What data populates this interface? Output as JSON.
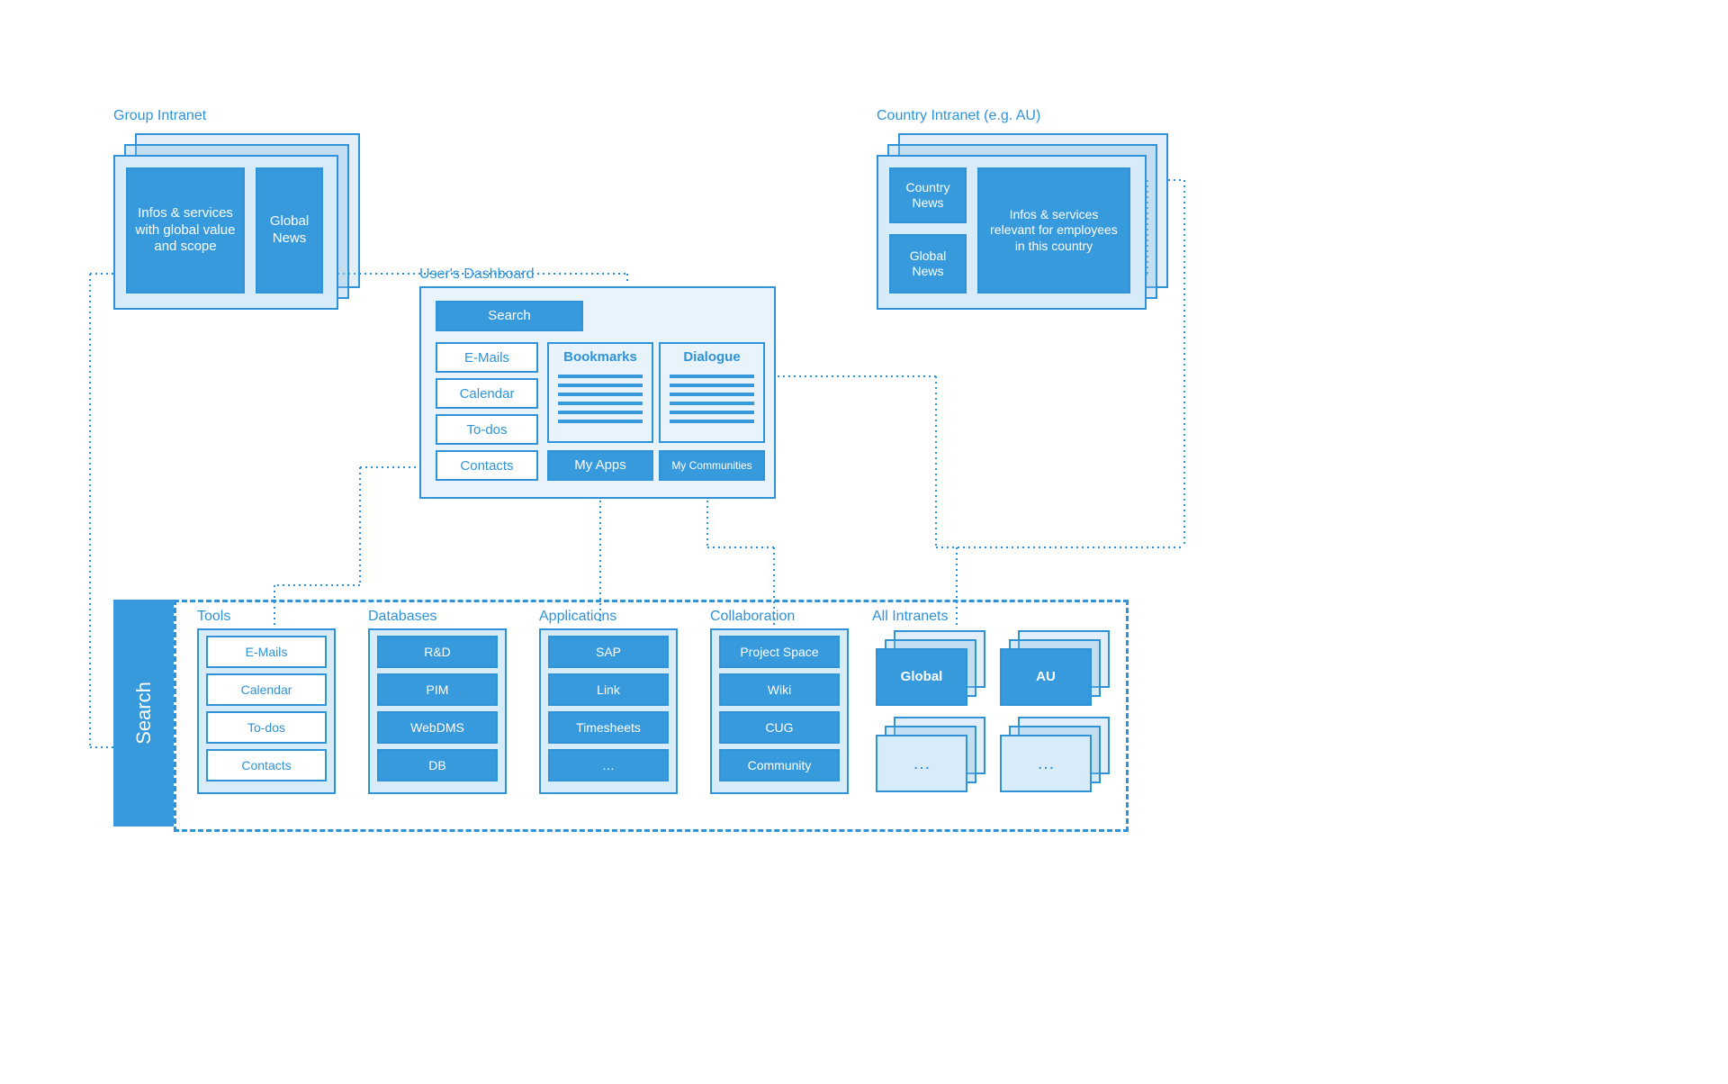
{
  "group_intranet": {
    "title": "Group Intranet",
    "info_block": "Infos & services with global value and scope",
    "news_block": "Global News"
  },
  "country_intranet": {
    "title": "Country Intranet (e.g. AU)",
    "country_news": "Country News",
    "global_news": "Global News",
    "info_block": "Infos & services relevant for employees in this country"
  },
  "dashboard": {
    "title": "User's Dashboard",
    "search": "Search",
    "left_items": [
      "E-Mails",
      "Calendar",
      "To-dos",
      "Contacts"
    ],
    "bookmarks_title": "Bookmarks",
    "dialogue_title": "Dialogue",
    "my_apps": "My Apps",
    "my_communities": "My Communities"
  },
  "search_label": "Search",
  "sections": {
    "tools": {
      "title": "Tools",
      "items": [
        "E-Mails",
        "Calendar",
        "To-dos",
        "Contacts"
      ],
      "style": "outline"
    },
    "databases": {
      "title": "Databases",
      "items": [
        "R&D",
        "PIM",
        "WebDMS",
        "DB"
      ],
      "style": "solid"
    },
    "applications": {
      "title": "Applications",
      "items": [
        "SAP",
        "Link",
        "Timesheets",
        "…"
      ],
      "style": "solid"
    },
    "collaboration": {
      "title": "Collaboration",
      "items": [
        "Project Space",
        "Wiki",
        "CUG",
        "Community"
      ],
      "style": "solid"
    },
    "intranets": {
      "title": "All Intranets",
      "cards": [
        "Global",
        "AU",
        "…",
        "…"
      ]
    }
  }
}
